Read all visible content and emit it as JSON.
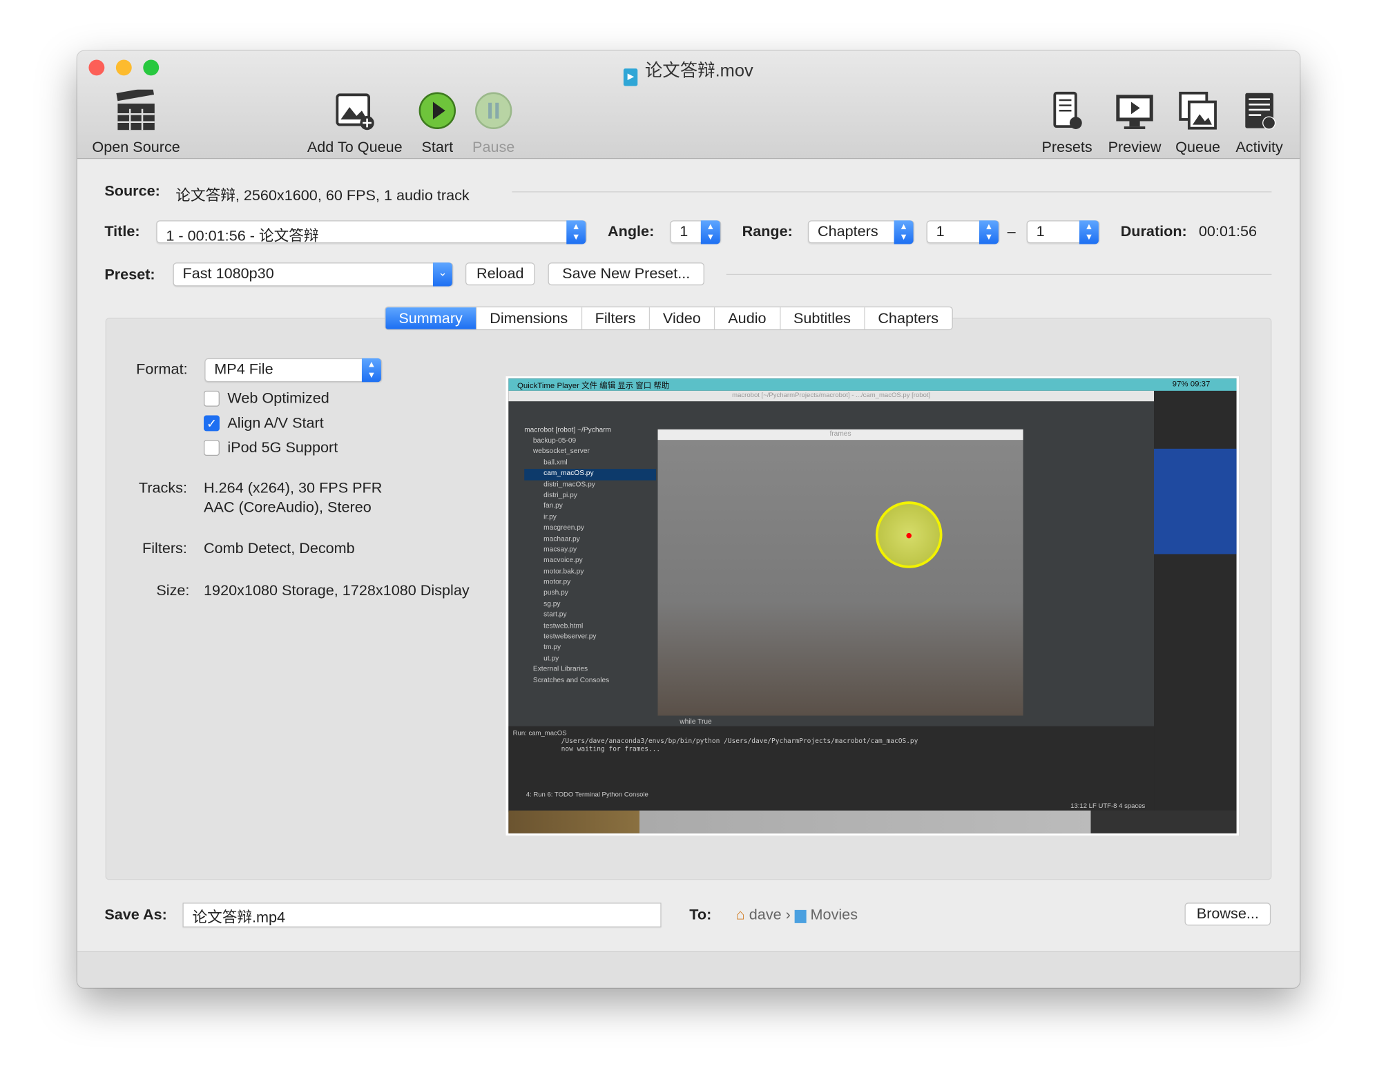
{
  "window": {
    "title": "论文答辩.mov"
  },
  "toolbar": {
    "open_source": "Open Source",
    "add_to_queue": "Add To Queue",
    "start": "Start",
    "pause": "Pause",
    "presets": "Presets",
    "preview": "Preview",
    "queue": "Queue",
    "activity": "Activity"
  },
  "source": {
    "label": "Source:",
    "value": "论文答辩, 2560x1600, 60 FPS, 1 audio track"
  },
  "title_row": {
    "label": "Title:",
    "value": "1 - 00:01:56 - 论文答辩",
    "angle_label": "Angle:",
    "angle": "1",
    "range_label": "Range:",
    "range": "Chapters",
    "range_from": "1",
    "range_sep": "–",
    "range_to": "1",
    "duration_label": "Duration:",
    "duration": "00:01:56"
  },
  "preset": {
    "label": "Preset:",
    "value": "Fast 1080p30",
    "reload": "Reload",
    "save_new": "Save New Preset..."
  },
  "tabs": [
    "Summary",
    "Dimensions",
    "Filters",
    "Video",
    "Audio",
    "Subtitles",
    "Chapters"
  ],
  "summary": {
    "format_label": "Format:",
    "format": "MP4 File",
    "web_optimized": "Web Optimized",
    "align_av": "Align A/V Start",
    "ipod": "iPod 5G Support",
    "checks": {
      "web_optimized": false,
      "align_av": true,
      "ipod": false
    },
    "tracks_label": "Tracks:",
    "tracks": [
      "H.264 (x264), 30 FPS PFR",
      "AAC (CoreAudio), Stereo"
    ],
    "filters_label": "Filters:",
    "filters": "Comb Detect, Decomb",
    "size_label": "Size:",
    "size": "1920x1080 Storage, 1728x1080 Display"
  },
  "preview_image": {
    "menubar": "QuickTime Player  文件  编辑  显示  窗口  帮助",
    "clock": "97%  09:37",
    "ide_title": "macrobot [~/PycharmProjects/macrobot] - .../cam_macOS.py [robot]",
    "frames_title": "frames",
    "project_root": "macrobot [robot] ~/Pycharm",
    "files": [
      "backup-05-09",
      "websocket_server",
      "ball.xml",
      "cam_macOS.py",
      "distri_macOS.py",
      "distri_pi.py",
      "fan.py",
      "ir.py",
      "macgreen.py",
      "machaar.py",
      "macsay.py",
      "macvoice.py",
      "motor.bak.py",
      "motor.py",
      "push.py",
      "sg.py",
      "start.py",
      "testweb.html",
      "testwebserver.py",
      "tm.py",
      "ut.py",
      "External Libraries",
      "Scratches and Consoles"
    ],
    "run_tab": "Run:  cam_macOS",
    "console": [
      "/Users/dave/anaconda3/envs/bp/bin/python /Users/dave/PycharmProjects/macrobot/cam_macOS.py",
      "now waiting for frames..."
    ],
    "code": "while True",
    "status": "13:12  LF  UTF-8  4 spaces",
    "bottom_tabs": "4: Run   6: TODO   Terminal   Python Console"
  },
  "save": {
    "label": "Save As:",
    "value": "论文答辩.mp4",
    "to_label": "To:",
    "path": [
      "dave",
      "Movies"
    ],
    "browse": "Browse..."
  },
  "colors": {
    "accent": "#1d6ff2",
    "start": "#5cb82e"
  }
}
